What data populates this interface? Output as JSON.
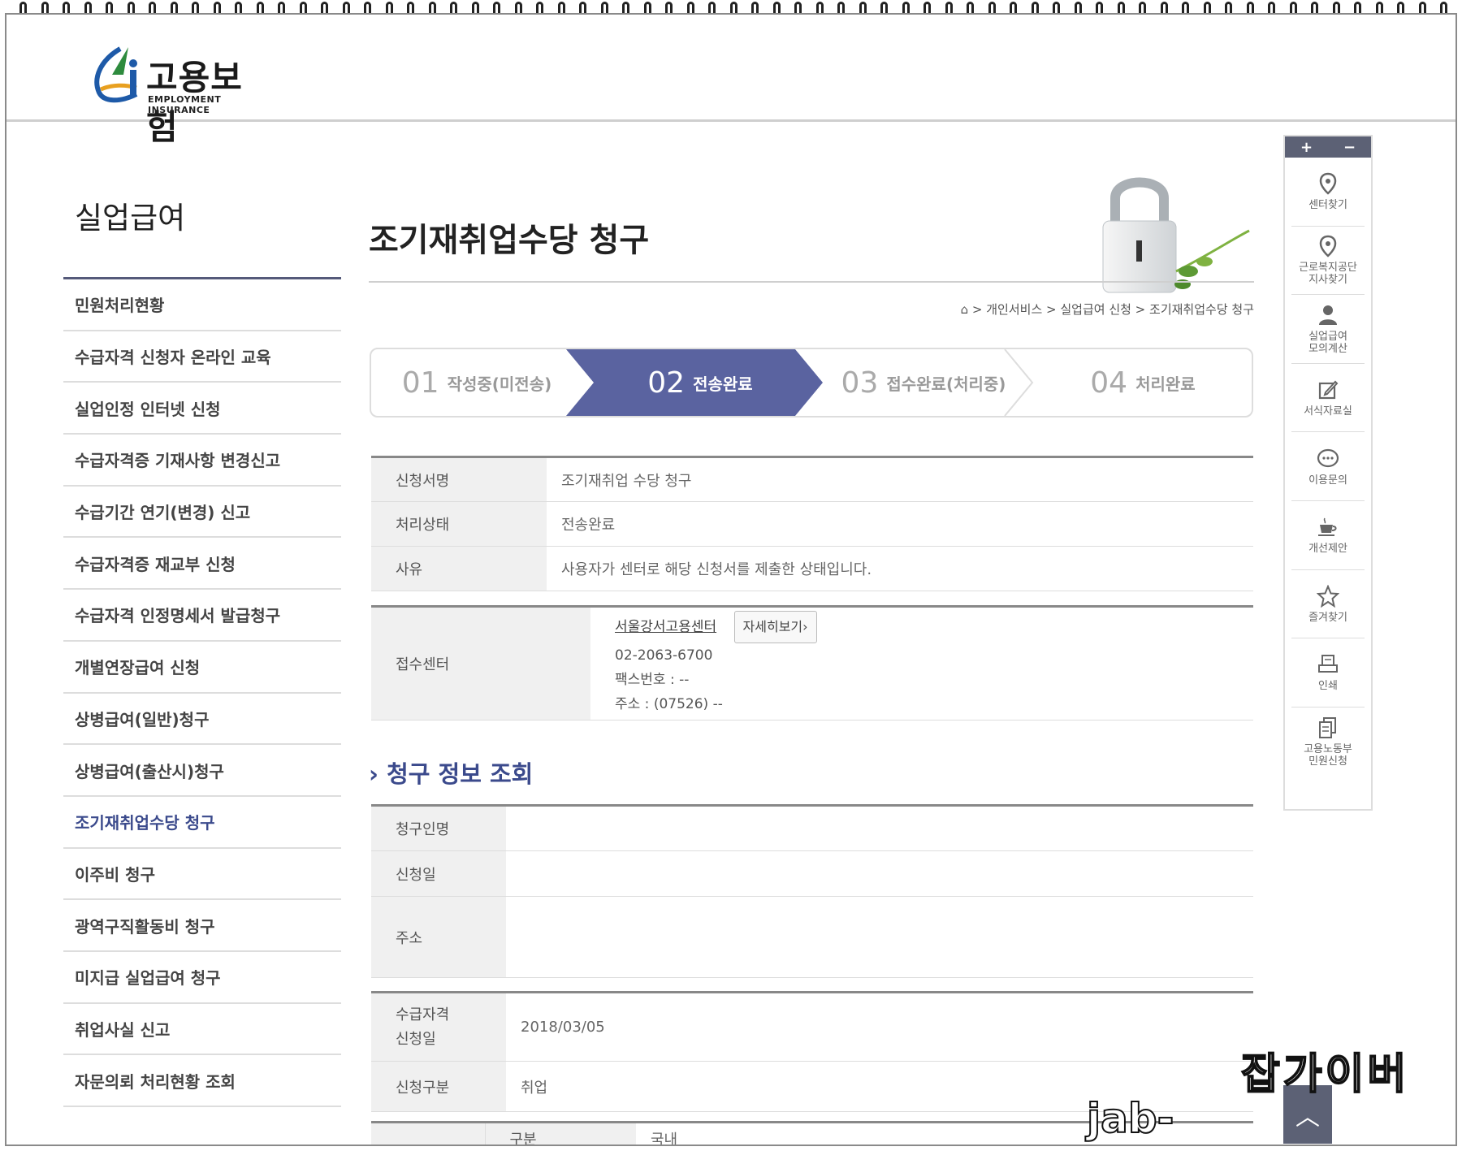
{
  "logo": {
    "text_ko": "고용보험",
    "text_en": "EMPLOYMENT INSURANCE"
  },
  "sidebar": {
    "title": "실업급여",
    "items": [
      {
        "label": "민원처리현황"
      },
      {
        "label": "수급자격 신청자 온라인 교육"
      },
      {
        "label": "실업인정 인터넷 신청"
      },
      {
        "label": "수급자격증 기재사항 변경신고"
      },
      {
        "label": "수급기간 연기(변경) 신고"
      },
      {
        "label": "수급자격증 재교부 신청"
      },
      {
        "label": "수급자격 인정명세서 발급청구"
      },
      {
        "label": "개별연장급여 신청"
      },
      {
        "label": "상병급여(일반)청구"
      },
      {
        "label": "상병급여(출산시)청구"
      },
      {
        "label": "조기재취업수당 청구"
      },
      {
        "label": "이주비 청구"
      },
      {
        "label": "광역구직활동비 청구"
      },
      {
        "label": "미지급 실업급여 청구"
      },
      {
        "label": "취업사실 신고"
      },
      {
        "label": "자문의뢰 처리현황 조회"
      }
    ]
  },
  "main": {
    "title": "조기재취업수당 청구",
    "breadcrumb": "> 개인서비스 > 실업급여 신청 > 조기재취업수당 청구"
  },
  "steps": [
    {
      "num": "01",
      "label": "작성중(미전송)"
    },
    {
      "num": "02",
      "label": "전송완료"
    },
    {
      "num": "03",
      "label": "접수완료(처리중)"
    },
    {
      "num": "04",
      "label": "처리완료"
    }
  ],
  "status_table": {
    "form_name_label": "신청서명",
    "form_name_value": "조기재취업 수당 청구",
    "status_label": "처리상태",
    "status_value": "전송완료",
    "reason_label": "사유",
    "reason_value": "사용자가 센터로 해당 신청서를 제출한 상태입니다."
  },
  "center": {
    "label": "접수센터",
    "name": "서울강서고용센터",
    "detail_button": "자세히보기›",
    "phone": "02-2063-6700",
    "fax": "팩스번호 : --",
    "address": "주소 : (07526) --"
  },
  "section": {
    "heading": "청구 정보 조회"
  },
  "claim_table": {
    "name_label": "청구인명",
    "date_label": "신청일",
    "address_label": "주소"
  },
  "qual_table": {
    "qual_date_label_1": "수급자격",
    "qual_date_label_2": "신청일",
    "qual_date_value": "2018/03/05",
    "type_label": "신청구분",
    "type_value": "취업"
  },
  "bottom_table": {
    "label": "구분",
    "value": "국내"
  },
  "quick_menu": {
    "plus": "+",
    "minus": "−",
    "items": [
      {
        "label": "센터찾기",
        "icon": "pin-icon"
      },
      {
        "label": "근로복지공단\n지사찾기",
        "icon": "pin-icon"
      },
      {
        "label": "실업급여\n모의계산",
        "icon": "person-icon"
      },
      {
        "label": "서식자료실",
        "icon": "edit-icon"
      },
      {
        "label": "이용문의",
        "icon": "chat-icon"
      },
      {
        "label": "개선제안",
        "icon": "cup-icon"
      },
      {
        "label": "즐겨찾기",
        "icon": "star-icon"
      },
      {
        "label": "인쇄",
        "icon": "print-icon"
      },
      {
        "label": "고용노동부\n민원신청",
        "icon": "docs-icon"
      }
    ]
  },
  "watermark": {
    "ko": "잡가이버",
    "url": "jab-guyver.co.kr"
  },
  "colors": {
    "accent": "#5a63a0",
    "accent_text": "#3b4a8c",
    "quick_bar": "#5c6175"
  }
}
